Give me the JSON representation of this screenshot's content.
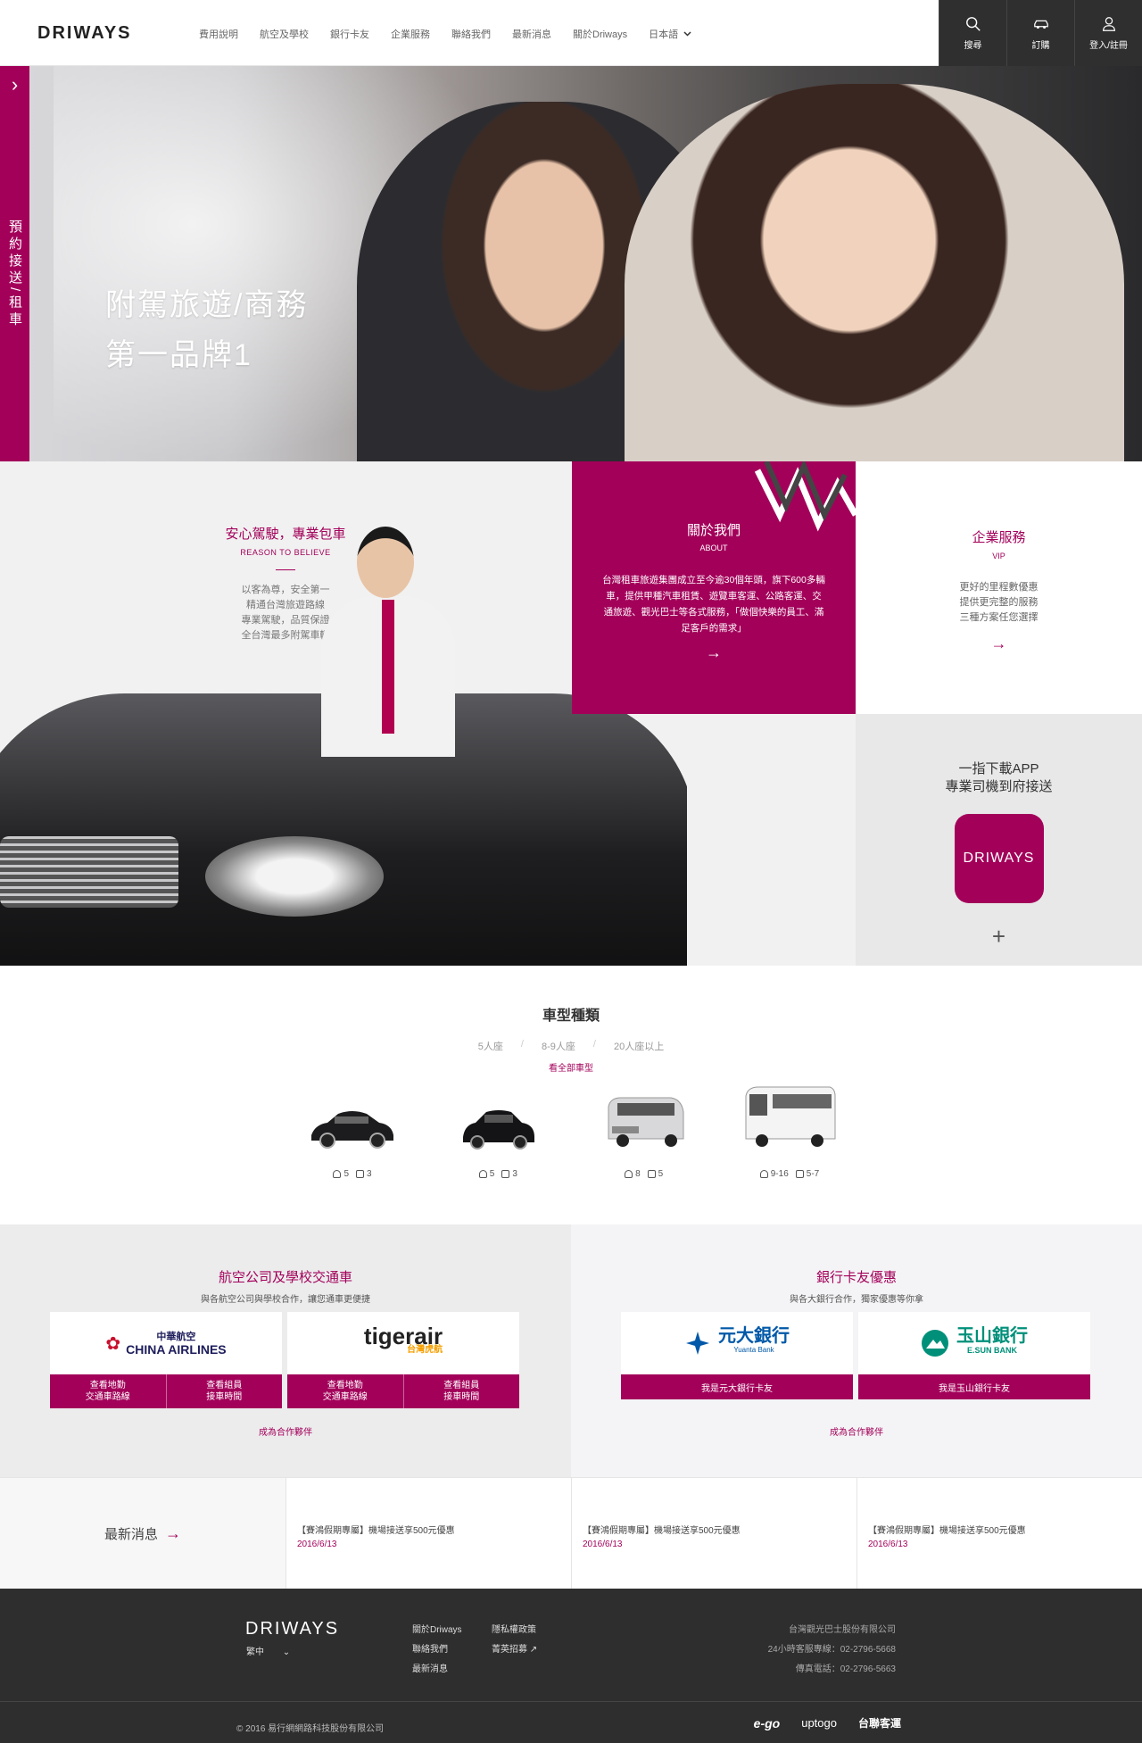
{
  "brand": {
    "logo": "DRIWAYS"
  },
  "nav": {
    "items": [
      "費用說明",
      "航空及學校",
      "銀行卡友",
      "企業服務",
      "聯絡我們",
      "最新消息",
      "關於Driways"
    ],
    "language": "日本語"
  },
  "header_actions": [
    {
      "label": "搜尋",
      "icon": "search-icon"
    },
    {
      "label": "訂購",
      "icon": "car-icon"
    },
    {
      "label": "登入/註冊",
      "icon": "user-icon"
    }
  ],
  "side_tab": {
    "label": "預約接送/租車"
  },
  "hero": {
    "line1": "附駕旅遊/商務",
    "line2": "第一品牌1"
  },
  "reason": {
    "title": "安心駕駛，專業包車",
    "subtitle": "REASON TO BELIEVE",
    "lines": [
      "以客為尊，安全第一",
      "精通台灣旅遊路線",
      "專業駕駛，品質保證",
      "全台灣最多附駕車輛"
    ]
  },
  "about": {
    "title": "關於我們",
    "subtitle": "ABOUT",
    "description": "台灣租車旅遊集團成立至今逾30個年頭，旗下600多輛車，提供甲種汽車租賃、遊覽車客運、公路客運、交通旅遊、觀光巴士等各式服務，「做個快樂的員工、滿足客戶的需求」",
    "arrow": "→"
  },
  "vip": {
    "title": "企業服務",
    "subtitle": "VIP",
    "lines": [
      "更好的里程數優惠",
      "提供更完整的服務",
      "三種方案任您選擇"
    ],
    "arrow": "→"
  },
  "app": {
    "line1": "一指下載APP",
    "line2": "專業司機到府接送",
    "icon_label": "DRIWAYS",
    "plus": "+"
  },
  "vehicles": {
    "title": "車型種類",
    "filters": [
      "5人座",
      "8-9人座",
      "20人座以上"
    ],
    "view_all": "看全部車型",
    "cars": [
      {
        "name": "sedan",
        "people": "5",
        "luggage": "3"
      },
      {
        "name": "luxury-sedan",
        "people": "5",
        "luggage": "3"
      },
      {
        "name": "van",
        "people": "8",
        "luggage": "5"
      },
      {
        "name": "bus",
        "people": "9-16",
        "luggage": "5-7"
      }
    ]
  },
  "airline": {
    "title": "航空公司及學校交通車",
    "subtitle": "與各航空公司與學校合作，讓您通車更便捷",
    "partners": [
      {
        "logo": "CHINA AIRLINES",
        "logo_cn": "中華航空",
        "btn1": "查看地勤\n交通車路線",
        "btn2": "查看組員\n接車時間"
      },
      {
        "logo": "tigerair",
        "logo_cn": "台灣虎航",
        "btn1": "查看地勤\n交通車路線",
        "btn2": "查看組員\n接車時間"
      }
    ],
    "more": "成為合作夥伴"
  },
  "bank": {
    "title": "銀行卡友優惠",
    "subtitle": "與各大銀行合作，獨家優惠等你拿",
    "partners": [
      {
        "logo": "元大銀行",
        "logo_en": "Yuanta Bank",
        "btn": "我是元大銀行卡友"
      },
      {
        "logo": "玉山銀行",
        "logo_en": "E.SUN BANK",
        "btn": "我是玉山銀行卡友"
      }
    ],
    "more": "成為合作夥伴"
  },
  "news": {
    "label": "最新消息",
    "arrow": "→",
    "items": [
      {
        "title": "【賽鴻假期專屬】機場接送享500元優惠",
        "date": "2016/6/13"
      },
      {
        "title": "【賽鴻假期專屬】機場接送享500元優惠",
        "date": "2016/6/13"
      },
      {
        "title": "【賽鴻假期專屬】機場接送享500元優惠",
        "date": "2016/6/13"
      }
    ]
  },
  "footer": {
    "logo": "DRIWAYS",
    "lang": "繁中",
    "links_col1": [
      "關於Driways",
      "聯絡我們",
      "最新消息"
    ],
    "links_col2": [
      "隱私權政策",
      "菁英招募"
    ],
    "company": "台灣觀光巴士股份有限公司",
    "hotline": "24小時客服專線：02-2796-5668",
    "fax": "傳真電話：02-2796-5663",
    "copyright": "© 2016 易行網網路科技股份有限公司",
    "brands": [
      "e-go",
      "uptogo",
      "台聯客運"
    ]
  },
  "colors": {
    "accent": "#a3005a",
    "dark": "#2e2e2e"
  }
}
